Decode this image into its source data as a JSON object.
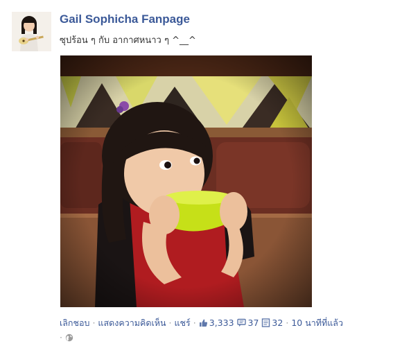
{
  "post": {
    "page_name": "Gail Sophicha Fanpage",
    "text": "ซุปร้อน ๆ กับ อากาศหนาว ๆ ^__^",
    "avatar_icon": "profile-photo-girl-with-ukulele",
    "photo_icon": "photo-girl-drinking-from-yellow-bowl"
  },
  "actions": {
    "like_label": "เลิกชอบ",
    "comment_label": "แสดงความคิดเห็น",
    "share_label": "แชร์",
    "likes_count": "3,333",
    "comments_count": "37",
    "shares_count": "32",
    "timestamp": "10 นาทีที่แล้ว",
    "separator": "·",
    "privacy_icon": "public-globe-icon"
  },
  "colors": {
    "link": "#3b5998",
    "text": "#333333",
    "meta": "#9a9a9a",
    "bowl": "#c6e018"
  }
}
